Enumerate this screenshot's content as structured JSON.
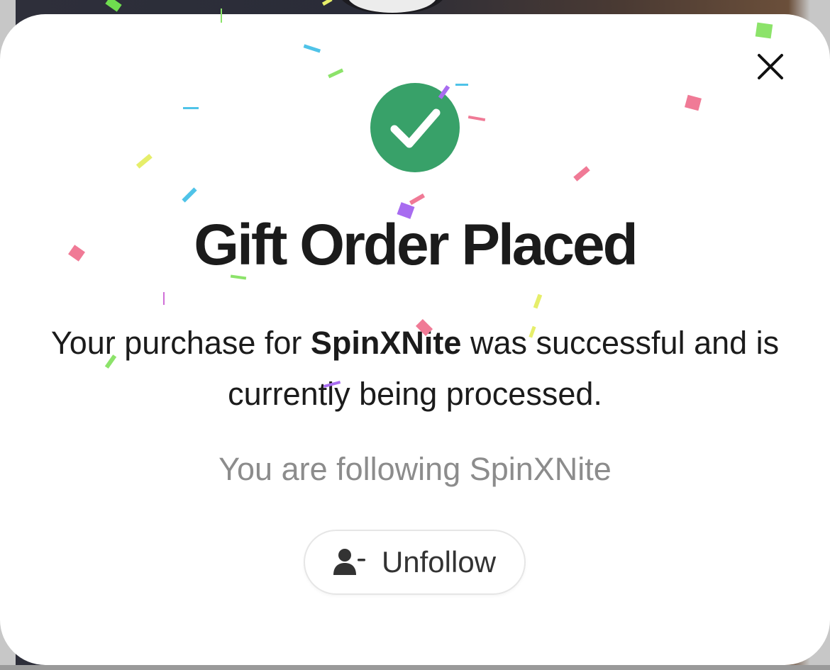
{
  "modal": {
    "title": "Gift Order Placed",
    "message_prefix": "Your purchase for ",
    "product_name": "SpinXNite",
    "message_suffix": " was successful and is currently being processed.",
    "following_text": "You are following SpinXNite",
    "unfollow_label": "Unfollow"
  },
  "icons": {
    "close": "close-icon",
    "success": "checkmark-icon",
    "unfollow": "user-minus-icon"
  },
  "colors": {
    "success_green": "#38a169",
    "title_text": "#1b1b1b",
    "muted_text": "#8c8c8c",
    "button_border": "#e6e6e6"
  }
}
